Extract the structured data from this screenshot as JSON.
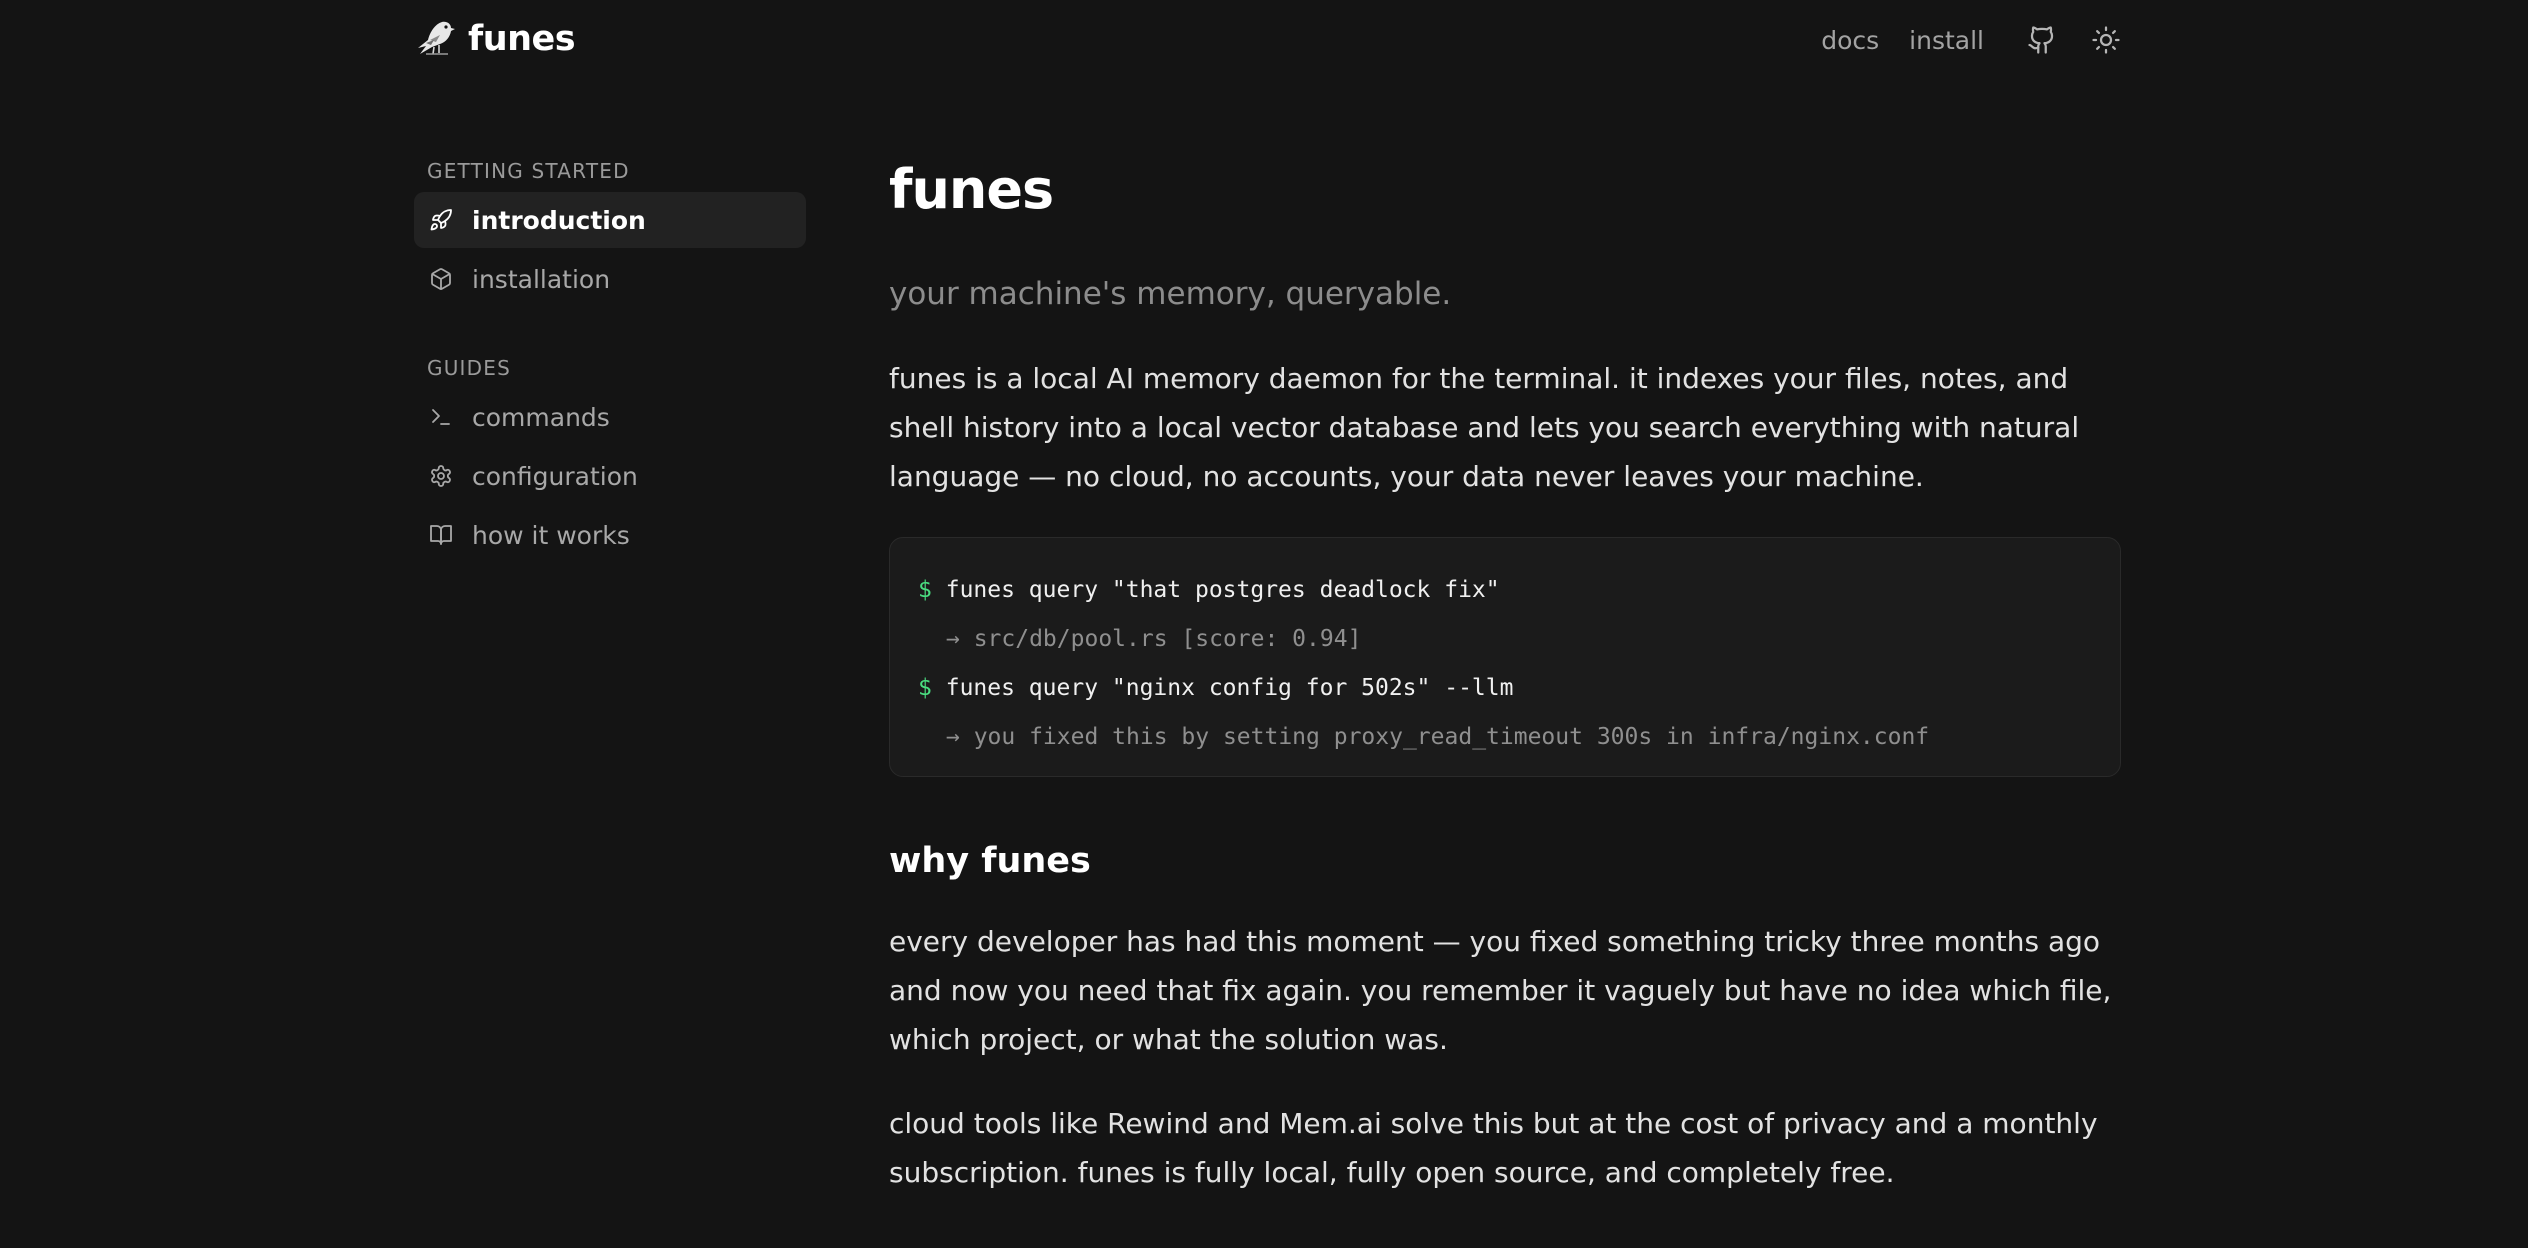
{
  "header": {
    "brand": "funes",
    "nav": {
      "docs": "docs",
      "install": "install"
    },
    "icons": [
      "bird-logo-icon",
      "github-icon",
      "sun-icon"
    ]
  },
  "sidebar": {
    "sections": [
      {
        "title": "GETTING STARTED",
        "items": [
          {
            "label": "introduction",
            "icon": "rocket-icon",
            "active": true
          },
          {
            "label": "installation",
            "icon": "package-icon",
            "active": false
          }
        ]
      },
      {
        "title": "GUIDES",
        "items": [
          {
            "label": "commands",
            "icon": "terminal-icon",
            "active": false
          },
          {
            "label": "configuration",
            "icon": "gear-icon",
            "active": false
          },
          {
            "label": "how it works",
            "icon": "book-icon",
            "active": false
          }
        ]
      }
    ]
  },
  "main": {
    "title": "funes",
    "tagline": "your machine's memory, queryable.",
    "intro": "funes is a local AI memory daemon for the terminal. it indexes your files, notes, and shell history into a local vector database and lets you search everything with natural language — no cloud, no accounts, your data never leaves your machine.",
    "code": {
      "lines": [
        {
          "prompt": "$",
          "text": "funes query \"that postgres deadlock fix\""
        },
        {
          "output": "→ src/db/pool.rs [score: 0.94]"
        },
        {
          "prompt": "$",
          "text": "funes query \"nginx config for 502s\" --llm"
        },
        {
          "output": "→ you fixed this by setting proxy_read_timeout 300s in infra/nginx.conf"
        }
      ]
    },
    "why": {
      "title": "why funes",
      "paragraphs": [
        "every developer has had this moment — you fixed something tricky three months ago and now you need that fix again. you remember it vaguely but have no idea which file, which project, or what the solution was.",
        "cloud tools like Rewind and Mem.ai solve this but at the cost of privacy and a monthly subscription. funes is fully local, fully open source, and completely free."
      ]
    }
  },
  "colors": {
    "background": "#141414",
    "active_item_bg": "#222222",
    "code_bg": "#1b1b1b",
    "prompt_green": "#4ade80",
    "muted_text": "#a3a3a3"
  }
}
